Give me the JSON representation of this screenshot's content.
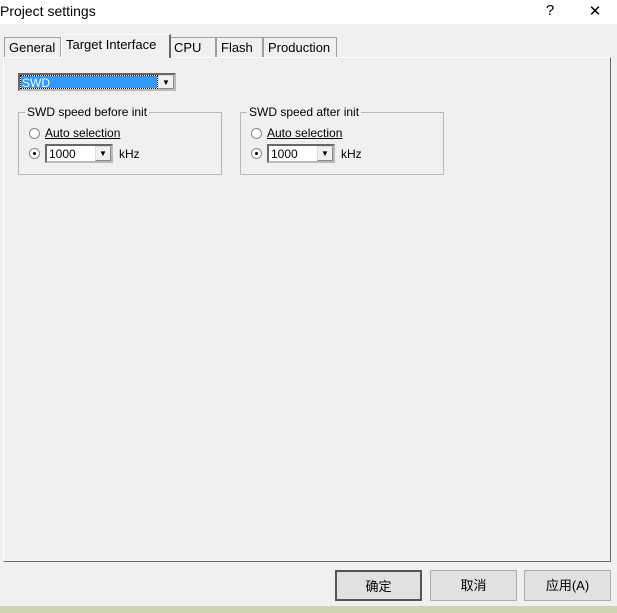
{
  "window": {
    "title": "Project settings",
    "help": "?",
    "close": "✕"
  },
  "tabs": [
    {
      "label": "General"
    },
    {
      "label": "Target Interface"
    },
    {
      "label": "CPU"
    },
    {
      "label": "Flash"
    },
    {
      "label": "Production"
    }
  ],
  "interface": {
    "selected": "SWD"
  },
  "before": {
    "title": "SWD speed before init",
    "auto_label": "Auto selection",
    "speed": "1000",
    "unit": "kHz",
    "auto_selected": false
  },
  "after": {
    "title": "SWD speed after init",
    "auto_label": "Auto selection",
    "speed": "1000",
    "unit": "kHz",
    "auto_selected": false
  },
  "buttons": {
    "ok": "确定",
    "cancel": "取消",
    "apply": "应用(A)"
  }
}
